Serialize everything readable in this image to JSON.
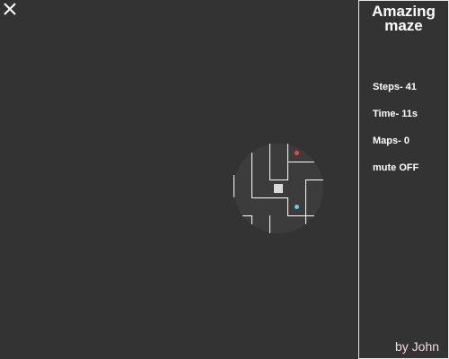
{
  "side_panel": {
    "title_line1": "Amazing",
    "title_line2": "maze",
    "steps_label": "Steps- 41",
    "time_label": "Time- 11s",
    "maps_label": "Maps- 0",
    "mute_label": "mute OFF",
    "author_label": "by John"
  },
  "colors": {
    "background": "#333333",
    "visible_area": "#3c3c3c",
    "wall": "#ffffff",
    "player": "#d9d9d9",
    "red_dot": "#e84a4a",
    "blue_dot": "#6ecbe8",
    "author_text": "#f4d8e6"
  },
  "icons": {
    "close": "close-icon"
  }
}
